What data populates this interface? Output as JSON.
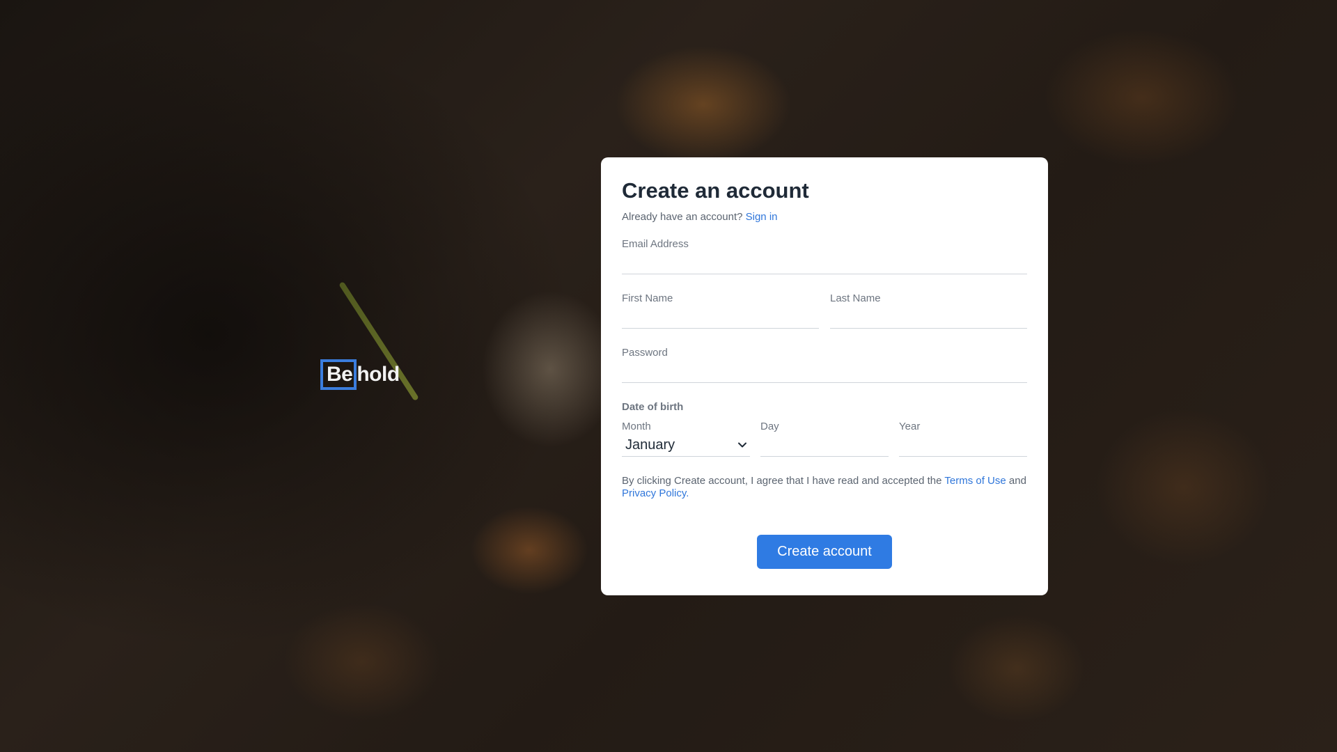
{
  "brand": {
    "logo_boxed": "Be",
    "logo_rest": "hold"
  },
  "form": {
    "title": "Create an account",
    "signin_prompt": "Already have an account?",
    "signin_link": "Sign in",
    "email_label": "Email Address",
    "first_name_label": "First Name",
    "last_name_label": "Last Name",
    "password_label": "Password",
    "dob_label": "Date of birth",
    "month_label": "Month",
    "month_value": "January",
    "day_label": "Day",
    "year_label": "Year",
    "terms_prefix": "By clicking Create account, I agree that I have read and accepted the",
    "terms_link": "Terms of Use",
    "terms_and": "and",
    "privacy_link": "Privacy Policy.",
    "submit_label": "Create account"
  },
  "colors": {
    "accent": "#2f7be3",
    "logo_box": "#3b7ddd"
  }
}
